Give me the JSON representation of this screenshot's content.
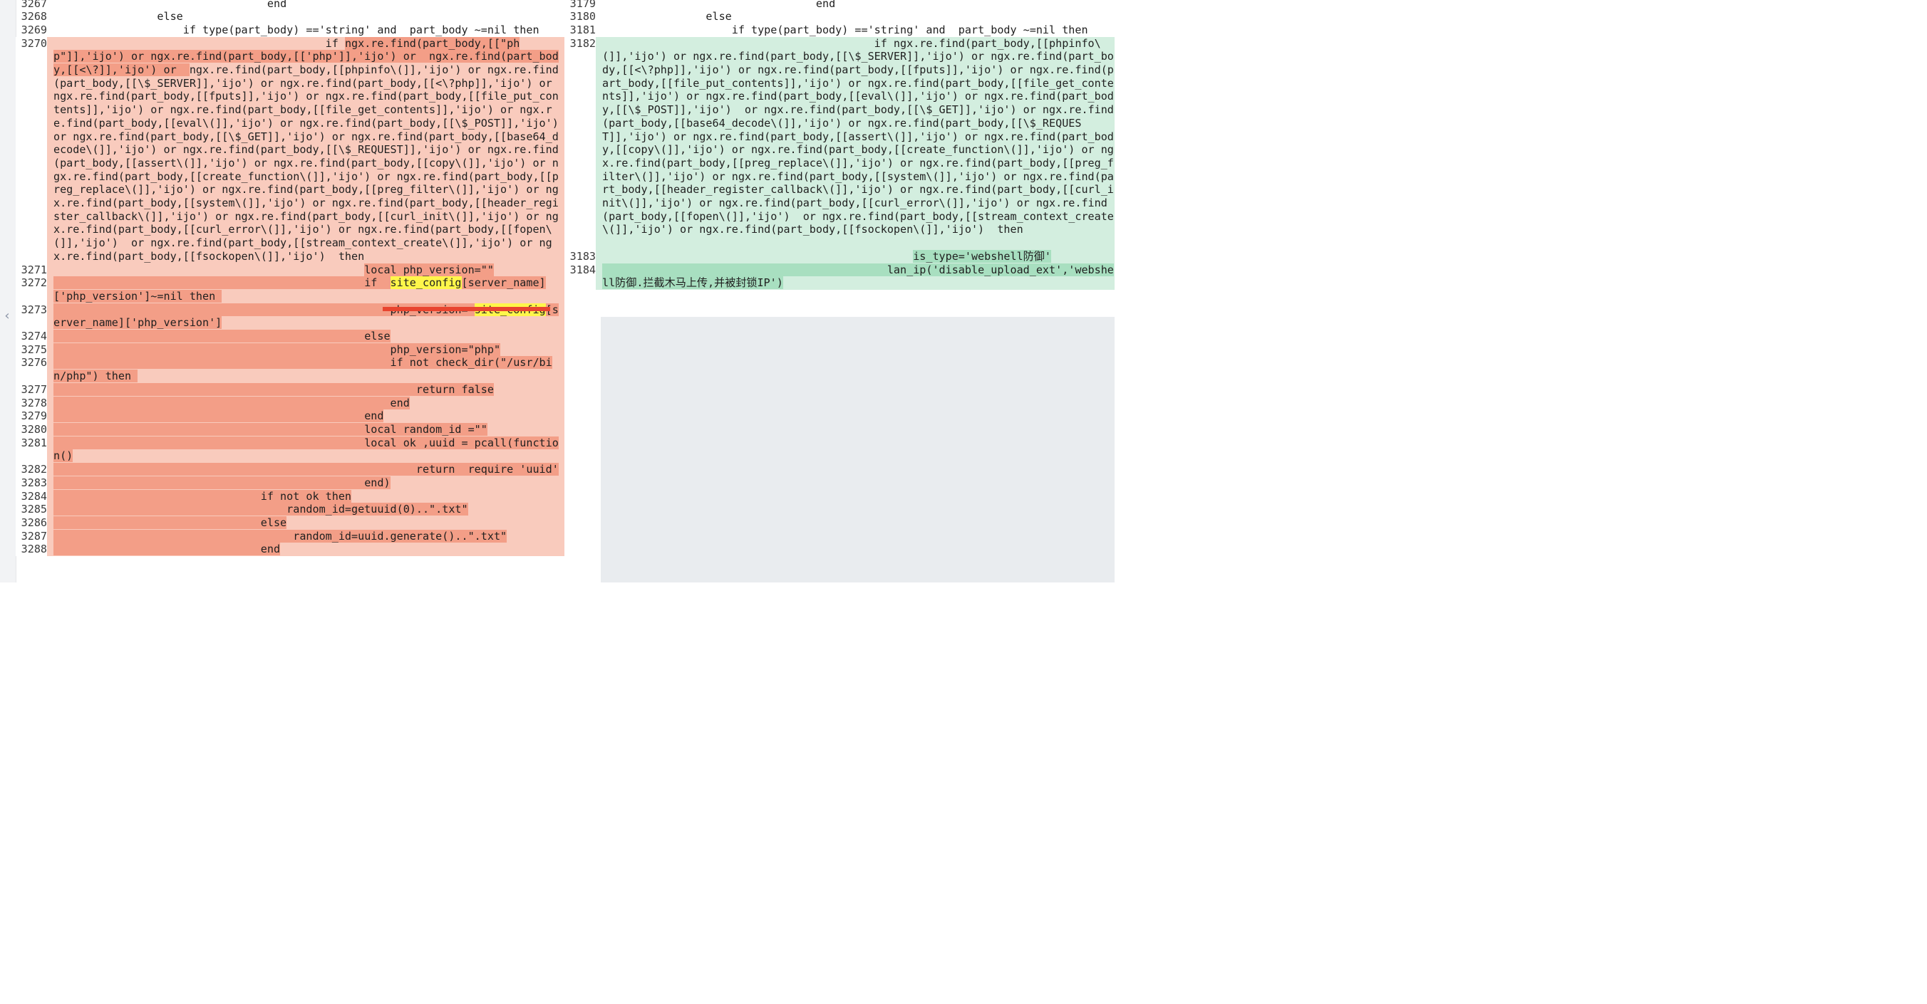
{
  "diff": {
    "collapse_icon": "chevron-left-icon",
    "left": {
      "lines": [
        {
          "n": "3267",
          "segs": [
            {
              "t": "                                 end"
            }
          ]
        },
        {
          "n": "3268",
          "segs": [
            {
              "t": "                else"
            }
          ]
        },
        {
          "n": "3269",
          "segs": [
            {
              "t": "                    if type(part_body) =='string' and  part_body ~=nil then"
            }
          ]
        },
        {
          "n": "3270",
          "cls": "del",
          "segs": [
            {
              "t": "                                          if "
            },
            {
              "t": "ngx.re.find(part_body,[[\"php\"]],'ijo') or ngx.re.find(part_body,[['php']],'ijo') or  ngx.re.find(part_body,[[<\\?]],'ijo') or  ",
              "h": "del"
            },
            {
              "t": "ngx.re.find(part_body,[[phpinfo\\(]],'ijo') or ngx.re.find(part_body,[[\\$_SERVER]],'ijo') or ngx.re.find(part_body,[[<\\?php]],'ijo') or ngx.re.find(part_body,[[fputs]],'ijo') or ngx.re.find(part_body,[[file_put_contents]],'ijo') or ngx.re.find(part_body,[[file_get_contents]],'ijo') or ngx.re.find(part_body,[[eval\\(]],'ijo') or ngx.re.find(part_body,[[\\$_POST]],'ijo')  or ngx.re.find(part_body,[[\\$_GET]],'ijo') or ngx.re.find(part_body,[[base64_decode\\(]],'ijo') or ngx.re.find(part_body,[[\\$_REQUEST]],'ijo') or ngx.re.find(part_body,[[assert\\(]],'ijo') or ngx.re.find(part_body,[[copy\\(]],'ijo') or ngx.re.find(part_body,[[create_function\\(]],'ijo') or ngx.re.find(part_body,[[preg_replace\\(]],'ijo') or ngx.re.find(part_body,[[preg_filter\\(]],'ijo') or ngx.re.find(part_body,[[system\\(]],'ijo') or ngx.re.find(part_body,[[header_register_callback\\(]],'ijo') or ngx.re.find(part_body,[[curl_init\\(]],'ijo') or ngx.re.find(part_body,[[curl_error\\(]],'ijo') or ngx.re.find(part_body,[[fopen\\(]],'ijo')  or ngx.re.find(part_body,[[stream_context_create\\(]],'ijo') or ngx.re.find(part_body,[[fsockopen\\(]],'ijo')  then"
            }
          ]
        },
        {
          "n": "3271",
          "cls": "del",
          "segs": [
            {
              "t": "                                                "
            },
            {
              "t": "local php_version=\"\"",
              "h": "del"
            }
          ]
        },
        {
          "n": "3272",
          "cls": "del",
          "segs": [
            {
              "t": "                                                ",
              "h": "del"
            },
            {
              "t": "if  ",
              "h": "del"
            },
            {
              "t": "site_config",
              "h": "match"
            },
            {
              "t": "[server_name]['php_version']~=nil then ",
              "h": "del"
            }
          ]
        },
        {
          "n": "3273",
          "cls": "del",
          "segs": [
            {
              "t": "                                                    ",
              "h": "del"
            },
            {
              "t": "php_version= ",
              "h": "del"
            },
            {
              "t": "site_config",
              "h": "match"
            },
            {
              "t": "[server_name]['php_version']",
              "h": "del"
            }
          ]
        },
        {
          "n": "3274",
          "cls": "del",
          "segs": [
            {
              "t": "                                                else",
              "h": "del"
            }
          ]
        },
        {
          "n": "3275",
          "cls": "del",
          "segs": [
            {
              "t": "                                                    php_version=\"php\"",
              "h": "del"
            }
          ]
        },
        {
          "n": "3276",
          "cls": "del",
          "segs": [
            {
              "t": "                                                    if not check_dir(\"/usr/bin/php\") then ",
              "h": "del"
            }
          ]
        },
        {
          "n": "3277",
          "cls": "del",
          "segs": [
            {
              "t": "                                                        return false",
              "h": "del"
            }
          ]
        },
        {
          "n": "3278",
          "cls": "del",
          "segs": [
            {
              "t": "                                                    end",
              "h": "del"
            }
          ]
        },
        {
          "n": "3279",
          "cls": "del",
          "segs": [
            {
              "t": "                                                end",
              "h": "del"
            }
          ]
        },
        {
          "n": "3280",
          "cls": "del",
          "segs": [
            {
              "t": "                                                local random_id =\"\"",
              "h": "del"
            }
          ]
        },
        {
          "n": "3281",
          "cls": "del",
          "segs": [
            {
              "t": "                                                local ok ,uuid = pcall(function()",
              "h": "del"
            }
          ]
        },
        {
          "n": "3282",
          "cls": "del",
          "segs": [
            {
              "t": "                                                        return  require 'uuid'",
              "h": "del"
            }
          ]
        },
        {
          "n": "3283",
          "cls": "del",
          "segs": [
            {
              "t": "                                                end)",
              "h": "del"
            }
          ]
        },
        {
          "n": "3284",
          "cls": "del",
          "segs": [
            {
              "t": "                                if not ok then",
              "h": "del"
            }
          ]
        },
        {
          "n": "3285",
          "cls": "del",
          "segs": [
            {
              "t": "                                    random_id=getuuid(0)..\".txt\"",
              "h": "del"
            }
          ]
        },
        {
          "n": "3286",
          "cls": "del",
          "segs": [
            {
              "t": "                                else",
              "h": "del"
            }
          ]
        },
        {
          "n": "3287",
          "cls": "del",
          "segs": [
            {
              "t": "                                     random_id=uuid.generate()..\".txt\"",
              "h": "del"
            }
          ]
        },
        {
          "n": "3288",
          "cls": "del",
          "segs": [
            {
              "t": "                                end",
              "h": "del"
            }
          ]
        }
      ]
    },
    "right": {
      "lines": [
        {
          "n": "3179",
          "segs": [
            {
              "t": "                                 end"
            }
          ]
        },
        {
          "n": "3180",
          "segs": [
            {
              "t": "                else"
            }
          ]
        },
        {
          "n": "3181",
          "segs": [
            {
              "t": "                    if type(part_body) =='string' and  part_body ~=nil then"
            }
          ]
        },
        {
          "n": "3182",
          "cls": "add",
          "segs": [
            {
              "t": "                                          if ngx.re.find(part_body,[[phpinfo\\(]],'ijo') or ngx.re.find(part_body,[[\\$_SERVER]],'ijo') or ngx.re.find(part_body,[[<\\?php]],'ijo') or ngx.re.find(part_body,[[fputs]],'ijo') or ngx.re.find(part_body,[[file_put_contents]],'ijo') or ngx.re.find(part_body,[[file_get_contents]],'ijo') or ngx.re.find(part_body,[[eval\\(]],'ijo') or ngx.re.find(part_body,[[\\$_POST]],'ijo')  or ngx.re.find(part_body,[[\\$_GET]],'ijo') or ngx.re.find(part_body,[[base64_decode\\(]],'ijo') or ngx.re.find(part_body,[[\\$_REQUEST]],'ijo') or ngx.re.find(part_body,[[assert\\(]],'ijo') or ngx.re.find(part_body,[[copy\\(]],'ijo') or ngx.re.find(part_body,[[create_function\\(]],'ijo') or ngx.re.find(part_body,[[preg_replace\\(]],'ijo') or ngx.re.find(part_body,[[preg_filter\\(]],'ijo') or ngx.re.find(part_body,[[system\\(]],'ijo') or ngx.re.find(part_body,[[header_register_callback\\(]],'ijo') or ngx.re.find(part_body,[[curl_init\\(]],'ijo') or ngx.re.find(part_body,[[curl_error\\(]],'ijo') or ngx.re.find(part_body,[[fopen\\(]],'ijo')  or ngx.re.find(part_body,[[stream_context_create\\(]],'ijo') or ngx.re.find(part_body,[[fsockopen\\(]],'ijo')  then\n\n"
            }
          ]
        },
        {
          "n": "3183",
          "cls": "add",
          "segs": [
            {
              "t": "                                                "
            },
            {
              "t": "is_type='webshell防御'",
              "h": "add"
            }
          ]
        },
        {
          "n": "3184",
          "cls": "add",
          "segs": [
            {
              "t": "                                            ",
              "h": "add"
            },
            {
              "t": "lan_ip('disable_upload_ext','webshell防御.拦截木马上传,并被封锁IP')",
              "h": "add"
            }
          ]
        }
      ]
    }
  }
}
